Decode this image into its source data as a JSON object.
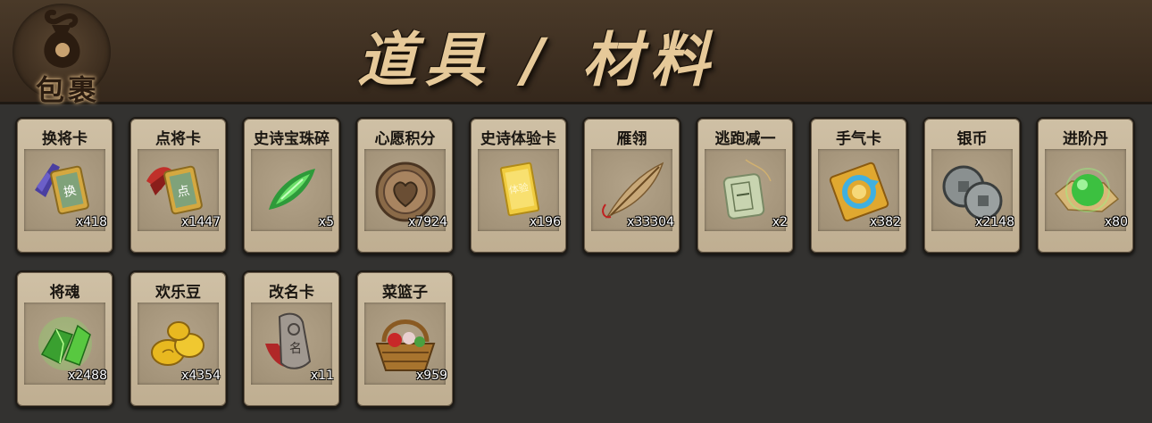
{
  "header": {
    "badge_label": "包裹",
    "title": "道具 / 材料"
  },
  "items": [
    {
      "name": "换将卡",
      "count": "x418",
      "icon": "hero-swap-card-icon"
    },
    {
      "name": "点将卡",
      "count": "x1447",
      "icon": "hero-pick-card-icon"
    },
    {
      "name": "史诗宝珠碎",
      "count": "x5",
      "icon": "green-gem-shard-icon"
    },
    {
      "name": "心愿积分",
      "count": "x7924",
      "icon": "heart-coin-icon"
    },
    {
      "name": "史诗体验卡",
      "count": "x196",
      "icon": "gold-card-icon"
    },
    {
      "name": "雁翎",
      "count": "x33304",
      "icon": "feather-icon"
    },
    {
      "name": "逃跑减一",
      "count": "x2",
      "icon": "jade-token-icon"
    },
    {
      "name": "手气卡",
      "count": "x382",
      "icon": "luck-card-icon"
    },
    {
      "name": "银币",
      "count": "x2148",
      "icon": "silver-coins-icon"
    },
    {
      "name": "进阶丹",
      "count": "x80",
      "icon": "green-pill-icon"
    },
    {
      "name": "将魂",
      "count": "x2488",
      "icon": "green-crystal-icon"
    },
    {
      "name": "欢乐豆",
      "count": "x4354",
      "icon": "gold-beans-icon"
    },
    {
      "name": "改名卡",
      "count": "x11",
      "icon": "rename-card-icon"
    },
    {
      "name": "菜篮子",
      "count": "x959",
      "icon": "basket-icon"
    }
  ]
}
